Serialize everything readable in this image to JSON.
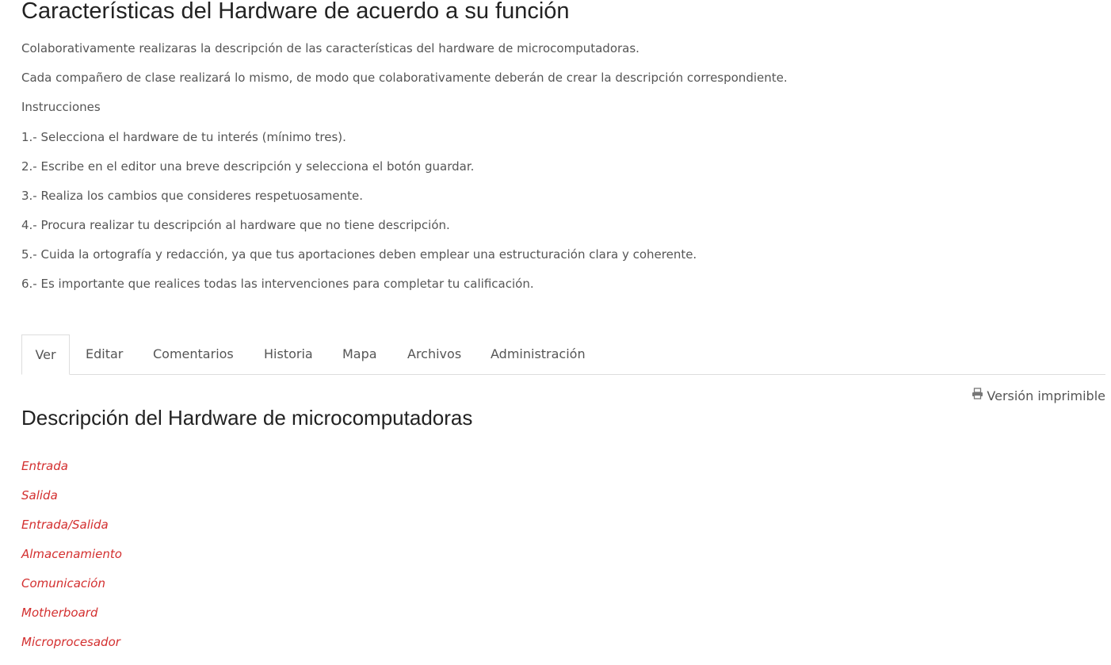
{
  "page_title": "Características del Hardware de acuerdo a su función",
  "intro": [
    "Colaborativamente realizaras la descripción de las características del hardware de microcomputadoras.",
    "Cada compañero de clase realizará lo mismo, de modo que colaborativamente deberán de crear la descripción correspondiente.",
    "Instrucciones",
    "1.- Selecciona el hardware de tu interés (mínimo tres).",
    "2.- Escribe en el editor una breve descripción y selecciona el botón guardar.",
    "3.- Realiza los cambios que consideres respetuosamente.",
    "4.- Procura realizar tu descripción al hardware que no tiene descripción.",
    "5.- Cuida la ortografía y redacción, ya que tus aportaciones deben emplear una estructuración clara y coherente.",
    "6.- Es importante que realices todas las intervenciones para completar tu calificación."
  ],
  "tabs": [
    {
      "label": "Ver",
      "active": true
    },
    {
      "label": "Editar",
      "active": false
    },
    {
      "label": "Comentarios",
      "active": false
    },
    {
      "label": "Historia",
      "active": false
    },
    {
      "label": "Mapa",
      "active": false
    },
    {
      "label": "Archivos",
      "active": false
    },
    {
      "label": "Administración",
      "active": false
    }
  ],
  "print_link": {
    "label": "Versión imprimible",
    "icon": "printer-icon"
  },
  "section_title": "Descripción del Hardware de microcomputadoras",
  "hardware_links": [
    "Entrada",
    "Salida",
    "Entrada/Salida",
    "Almacenamiento",
    "Comunicación",
    "Motherboard",
    "Microprocesador"
  ],
  "colors": {
    "link": "#d32f2f",
    "text": "#555555",
    "heading": "#222222",
    "border": "#dddddd"
  }
}
